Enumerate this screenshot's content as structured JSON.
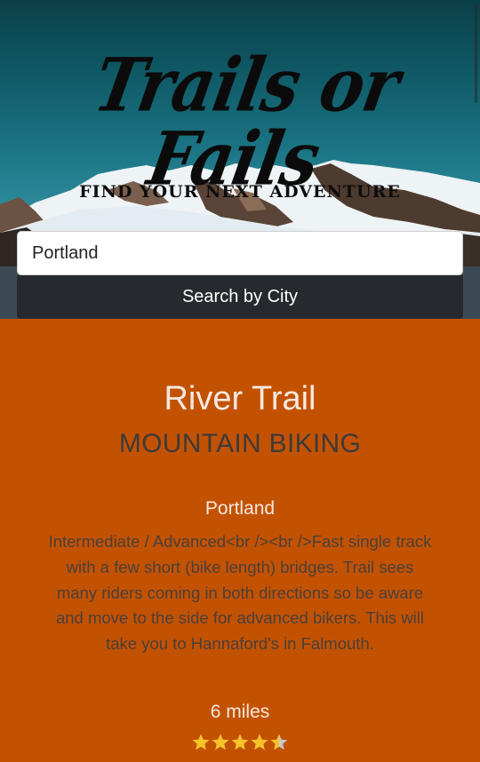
{
  "header": {
    "title": "Trails or Fails",
    "tagline": "FIND YOUR NEXT ADVENTURE"
  },
  "search": {
    "value": "Portland",
    "button_label": "Search by City"
  },
  "trail": {
    "name": "River Trail",
    "activity": "MOUNTAIN BIKING",
    "city": "Portland",
    "description": "Intermediate / Advanced<br /><br />Fast single track with a few short (bike length) bridges. Trail sees many riders coming in both directions so be aware and move to the side for advanced bikers. This will take you to Hannaford's in Falmouth.",
    "distance": "6 miles",
    "rating": {
      "value": 4.5,
      "max": 5
    }
  },
  "colors": {
    "accent": "#c35200",
    "button": "#262a2e",
    "star_filled": "#f6c229",
    "star_empty": "#c9c9c9"
  }
}
